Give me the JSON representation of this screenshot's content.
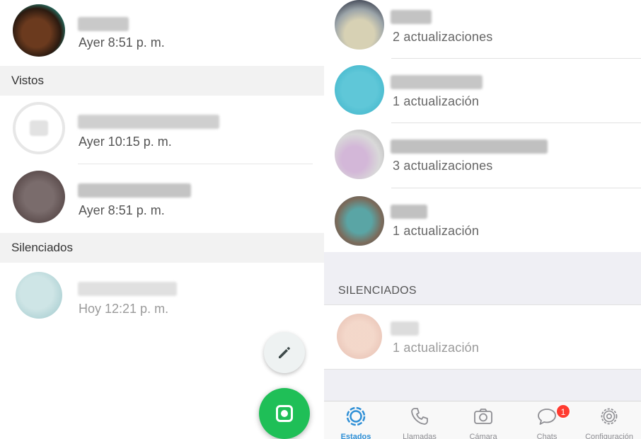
{
  "left_panel": {
    "top_item": {
      "time": "Ayer 8:51 p. m."
    },
    "sections": {
      "viewed": "Vistos",
      "muted": "Silenciados"
    },
    "viewed_items": [
      {
        "time": "Ayer 10:15 p. m."
      },
      {
        "time": "Ayer 8:51 p. m."
      }
    ],
    "muted_items": [
      {
        "time": "Hoy 12:21 p. m."
      }
    ],
    "fabs": {
      "text_status": "pencil-icon",
      "camera_status": "camera-icon"
    },
    "colors": {
      "fab_green": "#1fbf57"
    }
  },
  "right_panel": {
    "updates": [
      {
        "subtitle": "2 actualizaciones"
      },
      {
        "subtitle": "1 actualización"
      },
      {
        "subtitle": "3 actualizaciones"
      },
      {
        "subtitle": "1 actualización"
      }
    ],
    "muted_section": "SILENCIADOS",
    "muted_items": [
      {
        "subtitle": "1 actualización"
      }
    ],
    "tabbar": {
      "tabs": [
        {
          "label": "Estados",
          "icon": "status-icon",
          "active": true
        },
        {
          "label": "Llamadas",
          "icon": "phone-icon"
        },
        {
          "label": "Cámara",
          "icon": "camera-icon"
        },
        {
          "label": "Chats",
          "icon": "chat-bubble-icon",
          "badge": "1"
        },
        {
          "label": "Configuración",
          "icon": "gear-icon"
        }
      ]
    },
    "colors": {
      "active_tab": "#2e8fd6",
      "badge": "#ff3b30"
    }
  }
}
